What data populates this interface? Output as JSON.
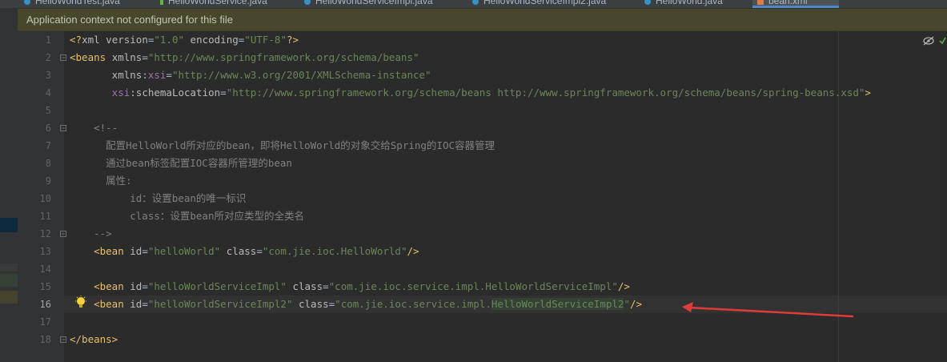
{
  "tabs": [
    {
      "label": "HelloWorldTest.java",
      "icon": "java-class-icon"
    },
    {
      "label": "HelloWorldService.java",
      "icon": "java-interface-icon"
    },
    {
      "label": "HelloWorldServiceImpl.java",
      "icon": "java-class-icon"
    },
    {
      "label": "HelloWorldServiceImpl2.java",
      "icon": "java-class-icon"
    },
    {
      "label": "HelloWorld.java",
      "icon": "java-class-icon"
    },
    {
      "label": "bean.xml",
      "icon": "xml-file-icon",
      "active": true
    }
  ],
  "banner": {
    "text": "Application context not configured for this file"
  },
  "current_line": 16,
  "line_numbers": [
    "1",
    "2",
    "3",
    "4",
    "5",
    "6",
    "7",
    "8",
    "9",
    "10",
    "11",
    "12",
    "13",
    "14",
    "15",
    "16",
    "17",
    "18"
  ],
  "code": {
    "l1": {
      "a": "<?",
      "b": "xml version",
      "c": "=",
      "d": "\"1.0\"",
      "e": " encoding",
      "f": "=",
      "g": "\"UTF-8\"",
      "h": "?>"
    },
    "l2": {
      "a": "<beans ",
      "b": "xmlns",
      "c": "=",
      "d": "\"http://www.springframework.org/schema/beans\""
    },
    "l3": {
      "a": "       xmlns",
      "b": ":",
      "c": "xsi",
      "d": "=",
      "e": "\"http://www.w3.org/2001/XMLSchema-instance\""
    },
    "l4": {
      "a": "       xsi",
      "b": ":schemaLocation",
      "c": "=",
      "d": "\"http://www.springframework.org/schema/beans http://www.springframework.org/schema/beans/spring-beans.xsd\"",
      "e": ">"
    },
    "l6": "    <!--",
    "l7": "      配置HelloWorld所对应的bean，即将HelloWorld的对象交给Spring的IOC容器管理",
    "l8": "      通过bean标签配置IOC容器所管理的bean",
    "l9": "      属性:",
    "l10": "          id：设置bean的唯一标识",
    "l11": "          class：设置bean所对应类型的全类名",
    "l12": "    -->",
    "l13": {
      "a": "    <bean ",
      "b": "id",
      "c": "=",
      "d": "\"helloWorld\"",
      "e": " class",
      "f": "=",
      "g": "\"com.jie.ioc.HelloWorld\"",
      "h": "/>"
    },
    "l15": {
      "a": "    <bean ",
      "b": "id",
      "c": "=",
      "d": "\"helloWorldServiceImpl\"",
      "e": " class",
      "f": "=",
      "g": "\"com.jie.ioc.service.impl.HelloWorldServiceImpl\"",
      "h": "/>"
    },
    "l16": {
      "a": "    <bean ",
      "b": "id",
      "c": "=",
      "d": "\"helloWorldServiceImpl2\"",
      "e": " class",
      "f": "=",
      "g1": "\"com.jie.ioc.service.impl.",
      "g2": "HelloWorldServiceImpl2",
      "g3": "\"",
      "h": "/>"
    },
    "l18": "</beans>"
  },
  "colors": {
    "annotation_arrow": "#e03a3a",
    "tag": "#e8bf6a",
    "value": "#6a8759",
    "comment": "#808080"
  }
}
